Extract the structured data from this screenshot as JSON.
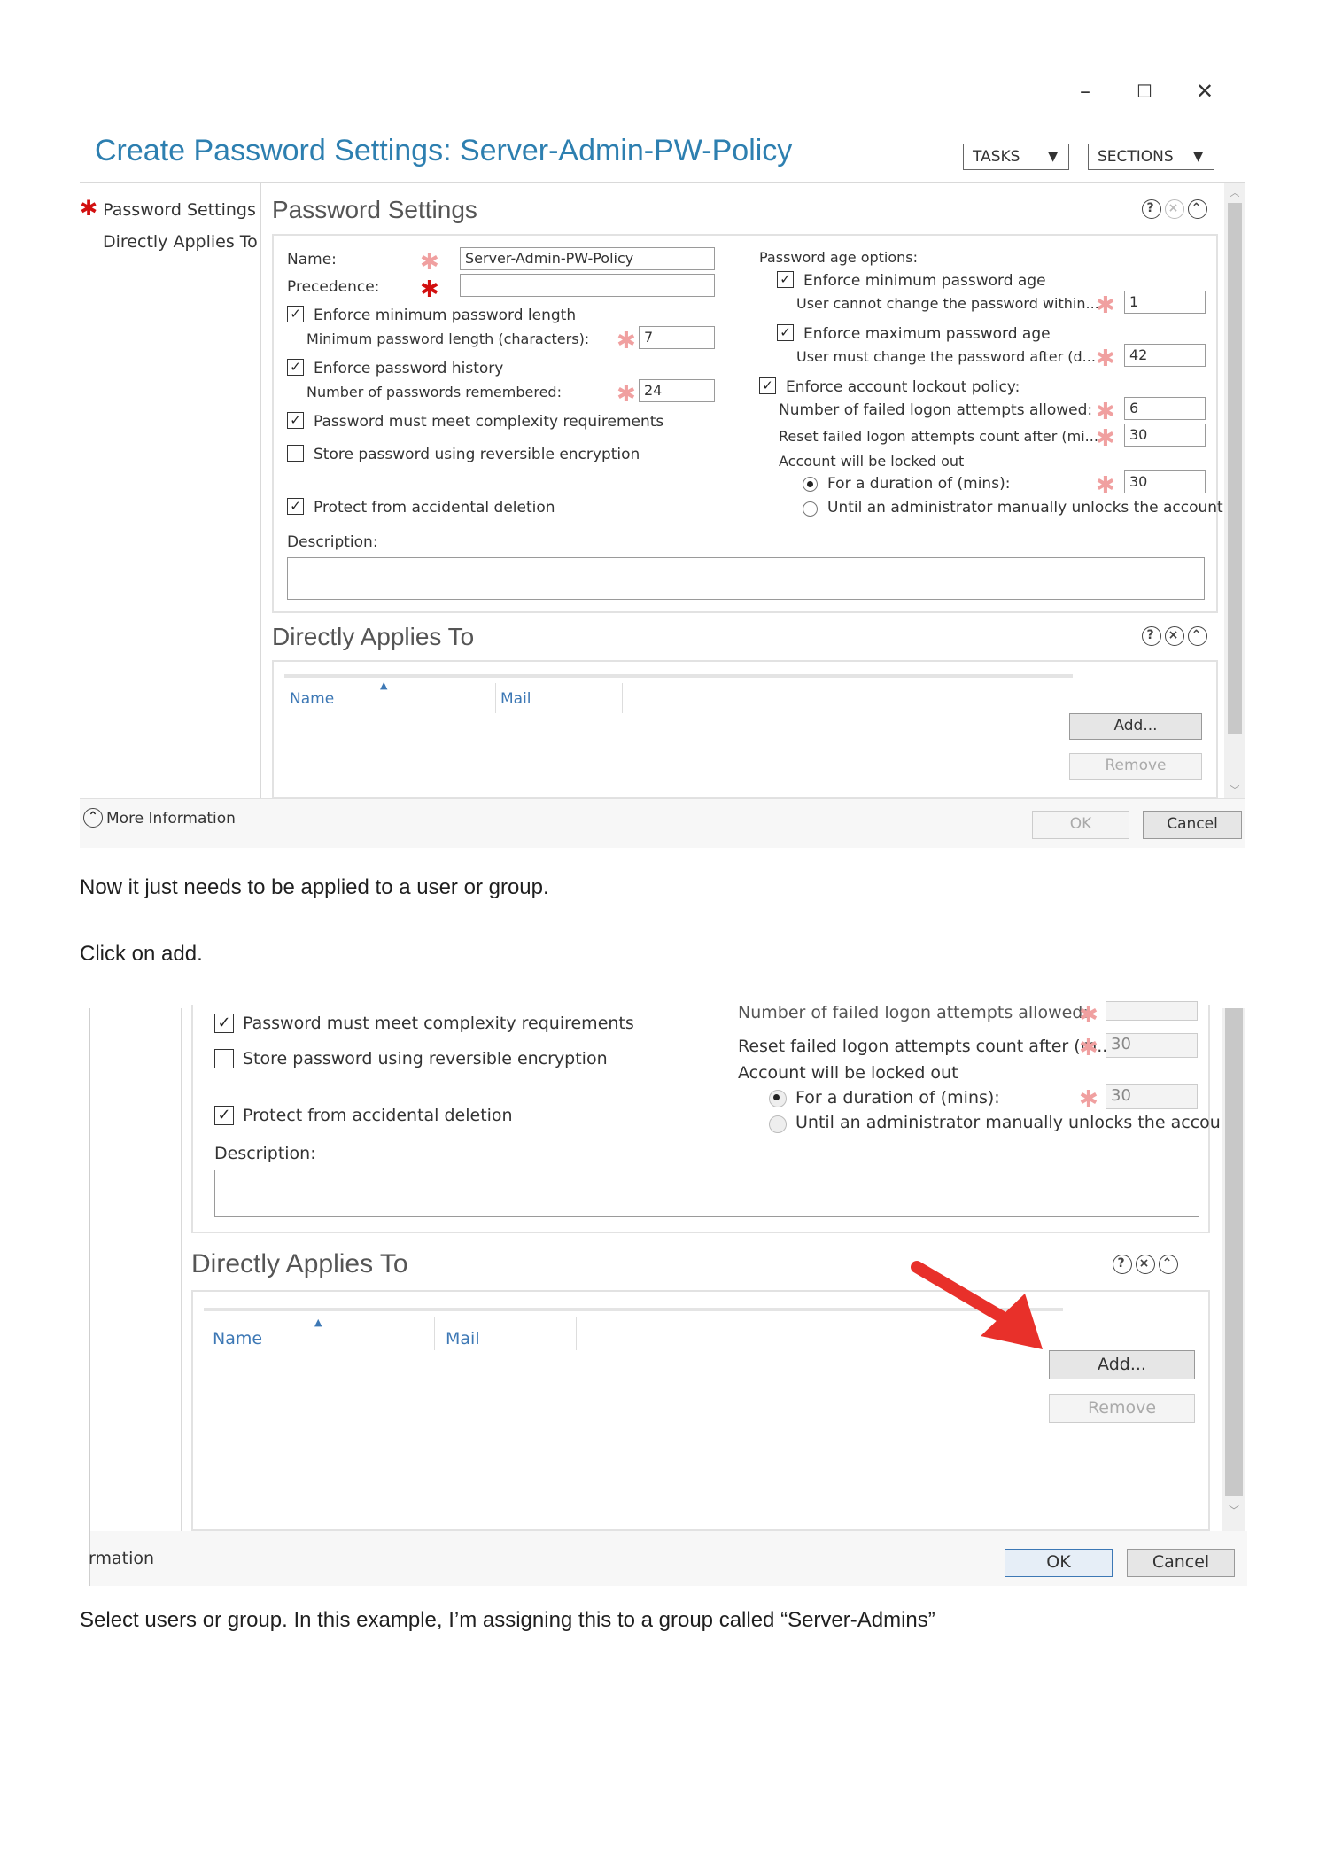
{
  "shot1": {
    "window_controls": {
      "minimize": "–",
      "maximize": "☐",
      "close": "✕"
    },
    "title": "Create Password Settings: Server-Admin-PW-Policy",
    "tasks_button": "TASKS",
    "sections_button": "SECTIONS",
    "nav": {
      "password_settings": "Password Settings",
      "directly_applies_to": "Directly Applies To"
    },
    "password_settings": {
      "heading": "Password Settings",
      "name_label": "Name:",
      "name_value": "Server-Admin-PW-Policy",
      "precedence_label": "Precedence:",
      "precedence_value": "",
      "enforce_min_length": "Enforce minimum password length",
      "min_length_label": "Minimum password length (characters):",
      "min_length_value": "7",
      "enforce_history": "Enforce password history",
      "history_label": "Number of passwords remembered:",
      "history_value": "24",
      "complexity": "Password must meet complexity requirements",
      "reversible": "Store password using reversible encryption",
      "protect": "Protect from accidental deletion",
      "description_label": "Description:",
      "age_options": "Password age options:",
      "enforce_min_age": "Enforce minimum password age",
      "min_age_label": "User cannot change the password within...",
      "min_age_value": "1",
      "enforce_max_age": "Enforce maximum password age",
      "max_age_label": "User must change the password after (d...",
      "max_age_value": "42",
      "lockout_policy": "Enforce account lockout policy:",
      "failed_attempts_label": "Number of failed logon attempts allowed:",
      "failed_attempts_value": "6",
      "reset_label": "Reset failed logon attempts count after (mi...",
      "reset_value": "30",
      "locked_out_label": "Account will be locked out",
      "duration_label": "For a duration of (mins):",
      "duration_value": "30",
      "until_admin": "Until an administrator manually unlocks the account"
    },
    "applies_to": {
      "heading": "Directly Applies To",
      "col_name": "Name",
      "col_mail": "Mail",
      "add": "Add...",
      "remove": "Remove"
    },
    "more_info": "More Information",
    "ok": "OK",
    "cancel": "Cancel"
  },
  "para1": "Now it just needs to be applied to a user or group.",
  "para2": "Click on add.",
  "shot2": {
    "complexity": "Password must meet complexity requirements",
    "reversible": "Store password using reversible encryption",
    "protect": "Protect from accidental deletion",
    "description_label": "Description:",
    "failed_attempts_label": "Number of failed logon attempts allowed:",
    "reset_label": "Reset failed logon attempts count after (m...",
    "reset_value": "30",
    "locked_out_label": "Account will be locked out",
    "duration_label": "For a duration of (mins):",
    "duration_value": "30",
    "until_admin": "Until an administrator manually unlocks the account",
    "applies_heading": "Directly Applies To",
    "col_name": "Name",
    "col_mail": "Mail",
    "add": "Add...",
    "remove": "Remove",
    "more_info_partial": "rmation",
    "ok": "OK",
    "cancel": "Cancel",
    "arrow_color": "#e8302a"
  },
  "para3": "Select users or group. In this example, I’m assigning this to a group called “Server-Admins”"
}
